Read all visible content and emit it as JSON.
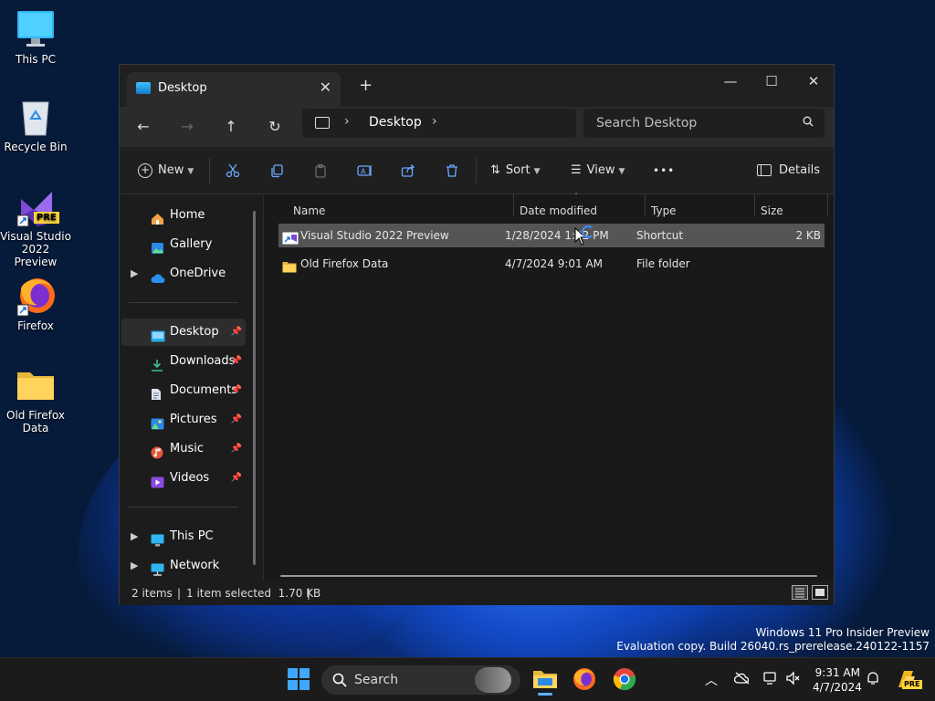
{
  "desktop": {
    "icons": [
      {
        "label": "This PC"
      },
      {
        "label": "Recycle Bin"
      },
      {
        "label": "Visual Studio 2022 Preview",
        "badge": "PRE"
      },
      {
        "label": "Firefox"
      },
      {
        "label": "Old Firefox Data"
      }
    ],
    "watermark": {
      "line1": "Windows 11 Pro Insider Preview",
      "line2": "Evaluation copy. Build 26040.rs_prerelease.240122-1157"
    }
  },
  "window": {
    "tab_title": "Desktop",
    "controls": {
      "minimize": "—",
      "maximize": "☐",
      "close": "✕"
    },
    "nav": {
      "back": "←",
      "forward": "→",
      "up": "↑",
      "refresh": "↻"
    },
    "breadcrumb": {
      "location": "Desktop"
    },
    "search": {
      "placeholder": "Search Desktop"
    },
    "toolbar": {
      "new_label": "New",
      "sort_label": "Sort",
      "view_label": "View",
      "more_label": "•••",
      "details_label": "Details"
    },
    "sidebar": {
      "top": [
        {
          "label": "Home"
        },
        {
          "label": "Gallery"
        },
        {
          "label": "OneDrive"
        }
      ],
      "pinned": [
        {
          "label": "Desktop"
        },
        {
          "label": "Downloads"
        },
        {
          "label": "Documents"
        },
        {
          "label": "Pictures"
        },
        {
          "label": "Music"
        },
        {
          "label": "Videos"
        }
      ],
      "bottom": [
        {
          "label": "This PC"
        },
        {
          "label": "Network"
        }
      ]
    },
    "columns": {
      "name": "Name",
      "date": "Date modified",
      "type": "Type",
      "size": "Size"
    },
    "files": [
      {
        "name": "Visual Studio 2022 Preview",
        "date": "1/28/2024 1:32 PM",
        "type": "Shortcut",
        "size": "2 KB"
      },
      {
        "name": "Old Firefox Data",
        "date": "4/7/2024 9:01 AM",
        "type": "File folder",
        "size": ""
      }
    ],
    "status": {
      "count": "2 items",
      "selection": "1 item selected  1.70 KB"
    }
  },
  "taskbar": {
    "search_placeholder": "Search",
    "time": "9:31 AM",
    "date": "4/7/2024",
    "tray_badge": "PRE"
  }
}
